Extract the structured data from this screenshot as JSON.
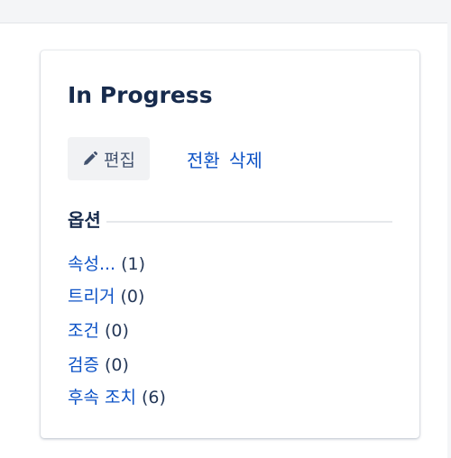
{
  "card": {
    "title": "In Progress",
    "edit_label": "편집",
    "actions": [
      "전환",
      "삭제"
    ],
    "options_heading": "옵션",
    "options": [
      {
        "label": "속성...",
        "count": "(1)"
      },
      {
        "label": "트리거",
        "count": "(0)"
      },
      {
        "label": "조건",
        "count": "(0)"
      },
      {
        "label": "검증",
        "count": "(0)"
      },
      {
        "label": "후속 조치",
        "count": "(6)"
      }
    ]
  },
  "icons": {
    "edit": "pencil-icon"
  },
  "colors": {
    "link": "#0c52c6",
    "text": "#172b4d",
    "button_bg": "#f1f2f4"
  }
}
